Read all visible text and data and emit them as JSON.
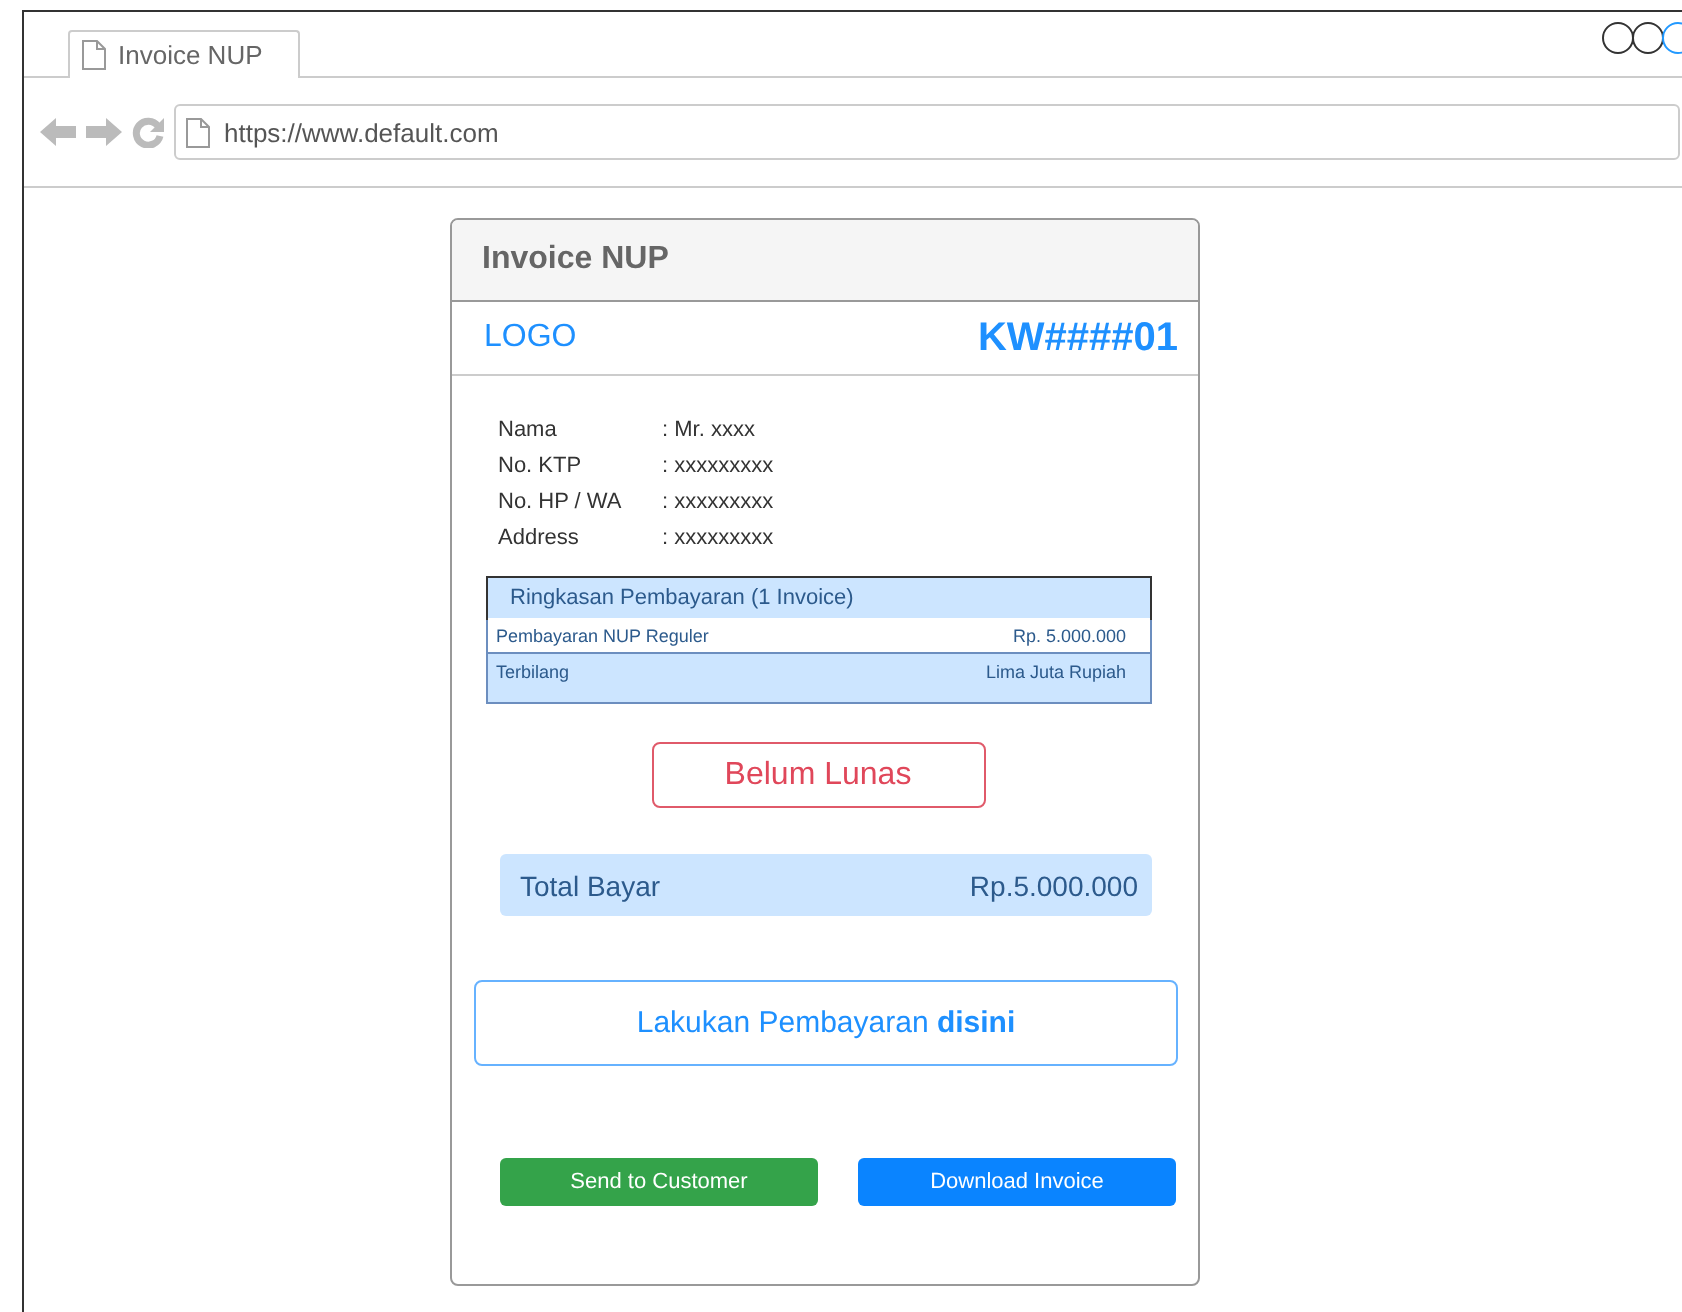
{
  "browser": {
    "tab_title": "Invoice NUP",
    "url": "https://www.default.com"
  },
  "card": {
    "title": "Invoice NUP",
    "logo": "LOGO",
    "invoice_number": "KW####01",
    "fields": [
      {
        "label": "Nama",
        "value": ": Mr. xxxx"
      },
      {
        "label": "No. KTP",
        "value": ": xxxxxxxxx"
      },
      {
        "label": "No. HP / WA",
        "value": ": xxxxxxxxx"
      },
      {
        "label": "Address",
        "value": ": xxxxxxxxx"
      }
    ],
    "summary": {
      "title": "Ringkasan Pembayaran  (1 Invoice)",
      "rows": [
        {
          "kind": "item",
          "label": "Pembayaran NUP Reguler",
          "value": "Rp. 5.000.000"
        },
        {
          "kind": "total",
          "label": "Terbilang",
          "value": "Lima Juta Rupiah"
        }
      ]
    },
    "status": "Belum Lunas",
    "total": {
      "label": "Total Bayar",
      "value": "Rp.5.000.000"
    },
    "pay_link": "Lakukan Pembayaran **disini**",
    "buttons": [
      {
        "kind": "success",
        "label": "Send to Customer"
      },
      {
        "kind": "primary",
        "label": "Download Invoice"
      }
    ]
  }
}
